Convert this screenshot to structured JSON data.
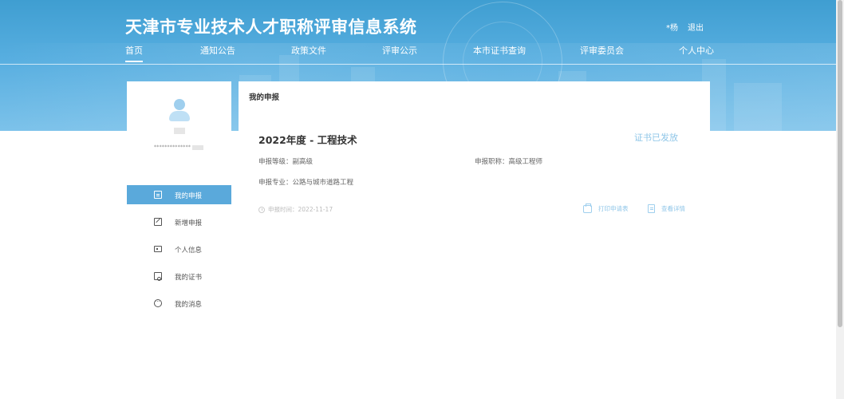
{
  "header": {
    "title": "天津市专业技术人才职称评审信息系统",
    "user_name": "*杨",
    "logout_label": "退出"
  },
  "nav": {
    "items": [
      {
        "label": "首页",
        "active": true
      },
      {
        "label": "通知公告"
      },
      {
        "label": "政策文件"
      },
      {
        "label": "评审公示"
      },
      {
        "label": "本市证书查询"
      },
      {
        "label": "评审委员会"
      },
      {
        "label": "个人中心"
      }
    ]
  },
  "profile": {
    "id_masked": "**************"
  },
  "sidebar": {
    "items": [
      {
        "label": "我的申报",
        "icon": "document-icon",
        "active": true
      },
      {
        "label": "新增申报",
        "icon": "edit-icon"
      },
      {
        "label": "个人信息",
        "icon": "id-card-icon"
      },
      {
        "label": "我的证书",
        "icon": "certificate-icon"
      },
      {
        "label": "我的消息",
        "icon": "message-icon"
      }
    ]
  },
  "main": {
    "section_title": "我的申报",
    "application": {
      "title": "2022年度 - 工程技术",
      "status": "证书已发放",
      "level": "申报等级：副高级",
      "position": "申报职称：高级工程师",
      "specialty": "申报专业：公路与城市道路工程",
      "time": "申报时间：2022-11-17",
      "print_label": "打印申请表",
      "details_label": "查看详情"
    }
  },
  "colors": {
    "accent": "#5aa9db",
    "status": "#8fc6e8",
    "banner": "#4aa6da"
  }
}
